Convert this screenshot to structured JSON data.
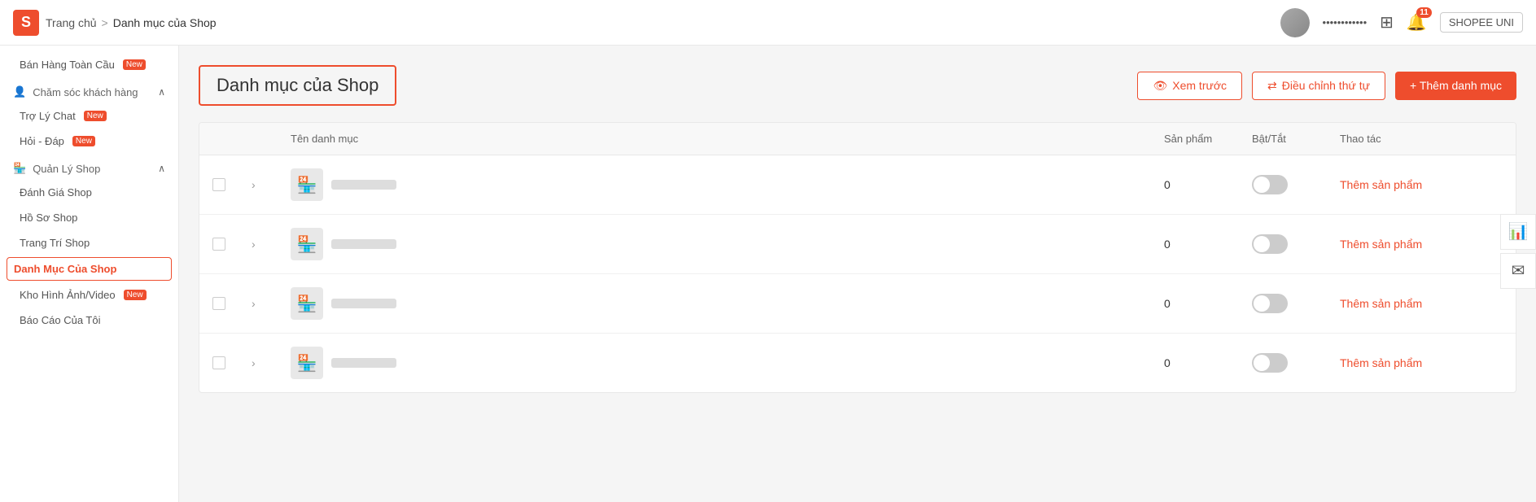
{
  "header": {
    "logo_letter": "S",
    "breadcrumb_home": "Trang chủ",
    "breadcrumb_sep": ">",
    "breadcrumb_current": "Danh mục của Shop",
    "username": "••••••••••••",
    "bell_count": "11",
    "shopee_uni": "SHOPEE UNI"
  },
  "sidebar": {
    "sections": [
      {
        "label": "Chăm sóc khách hàng",
        "items": [
          {
            "id": "tro-ly-chat",
            "label": "Trợ Lý Chat",
            "badge": "New"
          },
          {
            "id": "hoi-dap",
            "label": "Hỏi - Đáp",
            "badge": "New"
          }
        ]
      },
      {
        "label": "Quản Lý Shop",
        "items": [
          {
            "id": "danh-gia-shop",
            "label": "Đánh Giá Shop",
            "badge": ""
          },
          {
            "id": "ho-so-shop",
            "label": "Hồ Sơ Shop",
            "badge": ""
          },
          {
            "id": "trang-tri-shop",
            "label": "Trang Trí Shop",
            "badge": ""
          },
          {
            "id": "danh-muc-cua-shop",
            "label": "Danh Mục Của Shop",
            "badge": "",
            "active": true
          },
          {
            "id": "kho-hinh-anh",
            "label": "Kho Hình Ảnh/Video",
            "badge": "New"
          },
          {
            "id": "bao-cao-cua-toi",
            "label": "Báo Cáo Của Tôi",
            "badge": ""
          }
        ]
      }
    ],
    "top_item": "Bán Hàng Toàn Cầu",
    "top_item_badge": "New"
  },
  "page": {
    "title": "Danh mục của Shop",
    "btn_preview": "Xem trước",
    "btn_adjust": "Điều chỉnh thứ tự",
    "btn_add": "+ Thêm danh mục",
    "table": {
      "headers": [
        "",
        "",
        "Tên danh mục",
        "Sản phẩm",
        "Bật/Tắt",
        "Thao tác"
      ],
      "rows": [
        {
          "count": "0",
          "action": "Thêm sản phẩm"
        },
        {
          "count": "0",
          "action": "Thêm sản phẩm"
        },
        {
          "count": "0",
          "action": "Thêm sản phẩm"
        },
        {
          "count": "0",
          "action": "Thêm sản phẩm"
        }
      ]
    }
  },
  "float_icons": [
    {
      "id": "analytics-float",
      "symbol": "📊"
    },
    {
      "id": "message-float",
      "symbol": "✉"
    }
  ]
}
